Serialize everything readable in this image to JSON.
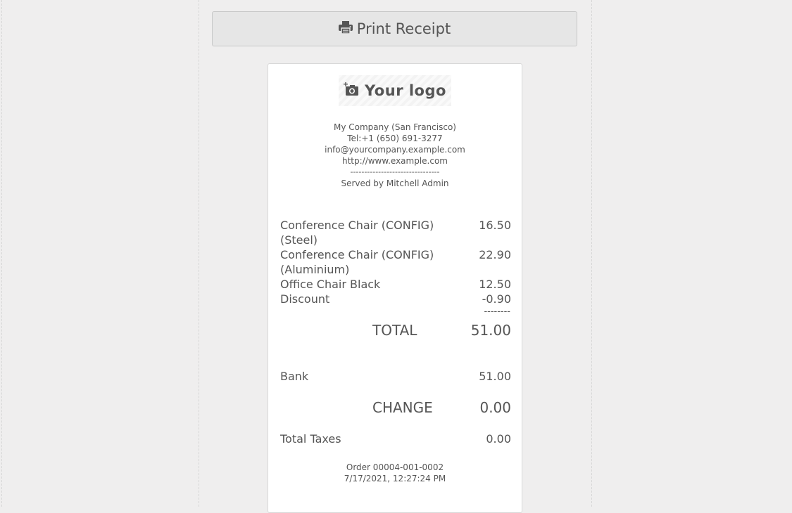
{
  "toolbar": {
    "print_label": "Print Receipt",
    "print_icon": "printer-icon"
  },
  "receipt": {
    "logo_text": "Your logo",
    "logo_icon": "camera-add-icon",
    "company": {
      "name": "My Company (San Francisco)",
      "phone": "Tel:+1 (650) 691-3277",
      "email": "info@yourcompany.example.com",
      "website": "http://www.example.com",
      "separator": "--------------------------------",
      "served_by": "Served by Mitchell Admin"
    },
    "lines": [
      {
        "name": "Conference Chair (CONFIG) (Steel)",
        "price": "16.50"
      },
      {
        "name": "Conference Chair (CONFIG) (Aluminium)",
        "price": "22.90"
      },
      {
        "name": "Office Chair Black",
        "price": "12.50"
      },
      {
        "name": "Discount",
        "price": "-0.90"
      }
    ],
    "subtotal_separator": "--------",
    "total": {
      "label": "TOTAL",
      "value": "51.00"
    },
    "payment": {
      "method": "Bank",
      "amount": "51.00"
    },
    "change": {
      "label": "CHANGE",
      "value": "0.00"
    },
    "taxes": {
      "label": "Total Taxes",
      "value": "0.00"
    },
    "order": {
      "number": "Order 00004-001-0002",
      "datetime": "7/17/2021, 12:27:24 PM"
    }
  }
}
